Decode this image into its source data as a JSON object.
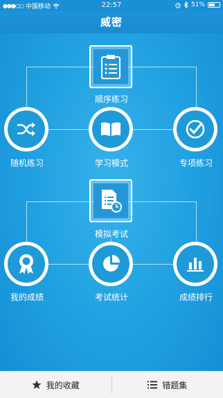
{
  "status_bar": {
    "carrier": "中国移动",
    "time": "22:57",
    "battery": "51%"
  },
  "nav": {
    "title": "威密"
  },
  "modes": {
    "sequential": "顺序练习",
    "random": "随机练习",
    "study": "学习模式",
    "special": "专项练习",
    "mock_exam": "模拟考试",
    "my_scores": "我的成绩",
    "exam_stats": "考试统计",
    "score_ranking": "成绩排行"
  },
  "bottom_bar": {
    "favorites": "我的收藏",
    "wrong_questions": "错题集"
  },
  "icons": {
    "sequential": "clipboard-list-icon",
    "random": "shuffle-icon",
    "study": "open-book-icon",
    "special": "check-circle-icon",
    "mock_exam": "document-clock-icon",
    "my_scores": "award-medal-icon",
    "exam_stats": "pie-chart-icon",
    "score_ranking": "bar-chart-icon",
    "favorites": "star-icon",
    "wrong_questions": "list-icon"
  },
  "colors": {
    "background": "#1f9fe0",
    "nav": "#1a8bd0",
    "icon_fill": "#1f9ad9",
    "bottom_bar": "#f3f3f3"
  }
}
